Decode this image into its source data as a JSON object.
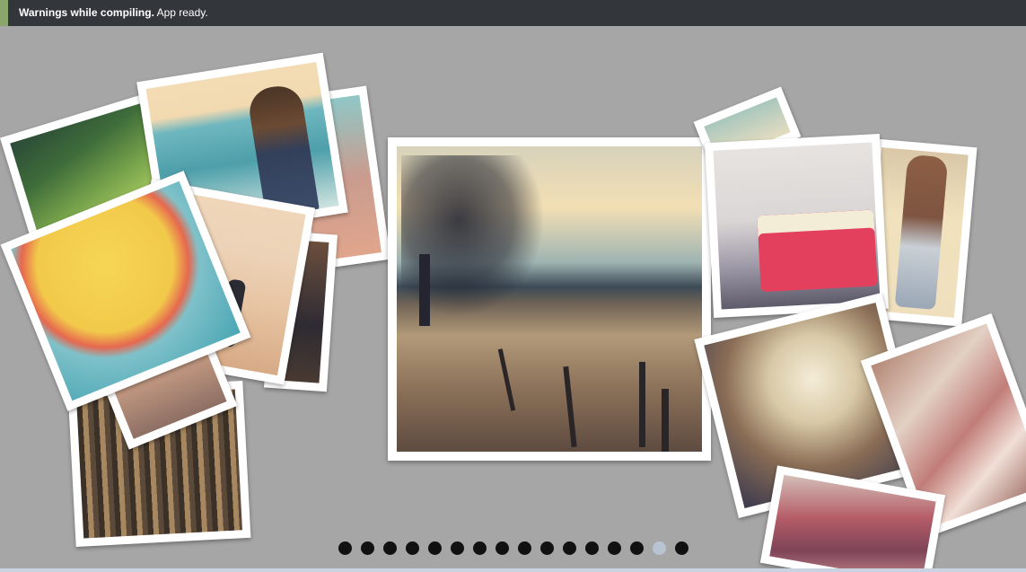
{
  "status": {
    "bold": "Warnings while compiling.",
    "text": " App ready.",
    "accent_color": "#8aa66c",
    "bar_color": "#33373c"
  },
  "gallery": {
    "background": "#a6a6a6",
    "photos": [
      {
        "name": "photo-rice-terraces",
        "subject": "rice terraces"
      },
      {
        "name": "photo-boy-on-beach",
        "subject": "boy on beach"
      },
      {
        "name": "photo-parasol",
        "subject": "parasol"
      },
      {
        "name": "photo-beach-runner",
        "subject": "beach runner"
      },
      {
        "name": "photo-gamelan",
        "subject": "gamelan"
      },
      {
        "name": "photo-field-tree",
        "subject": "field with tree and fence"
      },
      {
        "name": "photo-red-tram",
        "subject": "red tram"
      },
      {
        "name": "photo-man-in-shorts",
        "subject": "man in shorts"
      },
      {
        "name": "photo-dome-interior",
        "subject": "dome interior"
      },
      {
        "name": "photo-rooftops",
        "subject": "rooftops"
      },
      {
        "name": "photo-market-crowd",
        "subject": "market crowd"
      }
    ],
    "active_photo": "photo-field-tree"
  },
  "pagination": {
    "count": 16,
    "active_index": 14,
    "dot_color": "#111111",
    "active_color": "#b9c4d2"
  }
}
